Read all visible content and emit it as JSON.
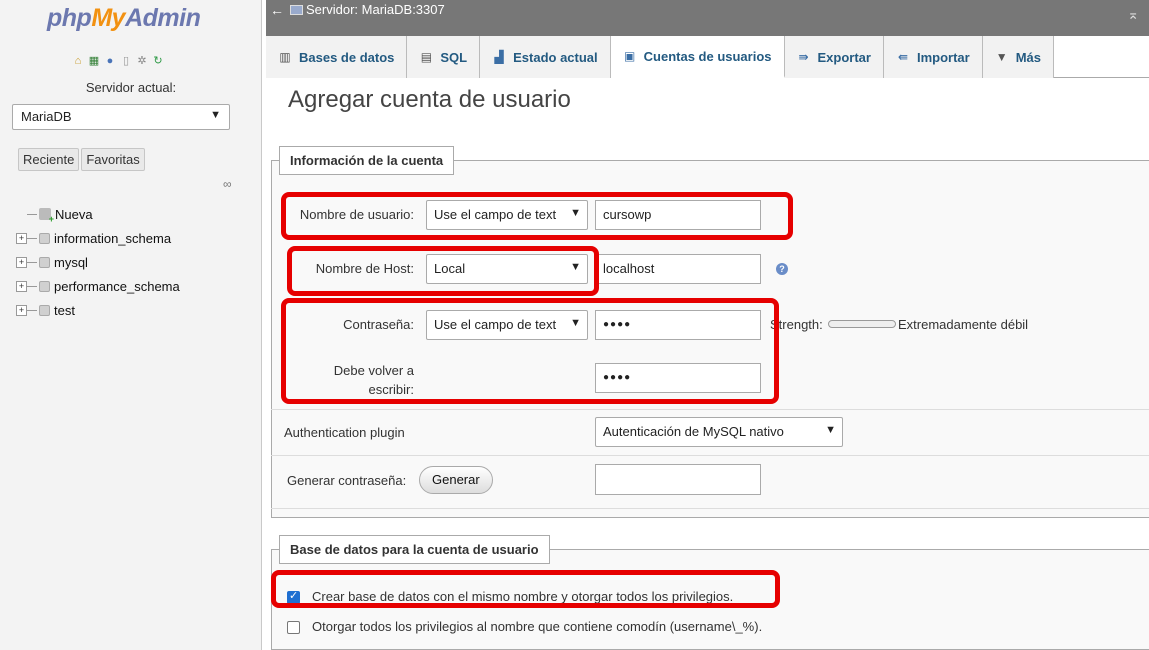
{
  "sidebar": {
    "logo": {
      "php": "php",
      "my": "My",
      "admin": "Admin"
    },
    "quick_icons": [
      "home-icon",
      "db-icon",
      "help-icon",
      "doc-icon",
      "settings-icon",
      "reload-icon"
    ],
    "server_label": "Servidor actual:",
    "server_value": "MariaDB",
    "nav_tabs": [
      "Reciente",
      "Favoritas"
    ],
    "tree": [
      {
        "label": "Nueva",
        "type": "new"
      },
      {
        "label": "information_schema",
        "type": "db"
      },
      {
        "label": "mysql",
        "type": "db"
      },
      {
        "label": "performance_schema",
        "type": "db"
      },
      {
        "label": "test",
        "type": "db"
      }
    ]
  },
  "topbar": {
    "title": "Servidor: MariaDB:3307"
  },
  "tabs": [
    {
      "label": "Bases de datos",
      "icon": "database-icon"
    },
    {
      "label": "SQL",
      "icon": "sql-icon"
    },
    {
      "label": "Estado actual",
      "icon": "status-icon"
    },
    {
      "label": "Cuentas de usuarios",
      "icon": "users-icon",
      "active": true
    },
    {
      "label": "Exportar",
      "icon": "export-icon"
    },
    {
      "label": "Importar",
      "icon": "import-icon"
    },
    {
      "label": "Más",
      "icon": "more-icon"
    }
  ],
  "page": {
    "title": "Agregar cuenta de usuario"
  },
  "account": {
    "legend": "Información de la cuenta",
    "username_label": "Nombre de usuario:",
    "username_mode": "Use el campo de text",
    "username_value": "cursowp",
    "host_label": "Nombre de Host:",
    "host_mode": "Local",
    "host_value": "localhost",
    "password_label": "Contraseña:",
    "password_mode": "Use el campo de text",
    "password_value": "●●●●",
    "strength_label": "Strength:",
    "strength_text": "Extremadamente débil",
    "retype_label_1": "Debe volver a",
    "retype_label_2": "escribir:",
    "retype_value": "●●●●",
    "auth_label": "Authentication plugin",
    "auth_value": "Autenticación de MySQL nativo",
    "generate_label": "Generar contraseña:",
    "generate_button": "Generar",
    "generate_value": ""
  },
  "database": {
    "legend": "Base de datos para la cuenta de usuario",
    "option_create": "Crear base de datos con el mismo nombre y otorgar todos los privilegios.",
    "option_create_checked": true,
    "option_wildcard": "Otorgar todos los privilegios al nombre que contiene comodín (username\\_%).",
    "option_wildcard_checked": false
  },
  "colors": {
    "highlight": "#e60000",
    "link": "#235a81",
    "topbar": "#777777"
  }
}
